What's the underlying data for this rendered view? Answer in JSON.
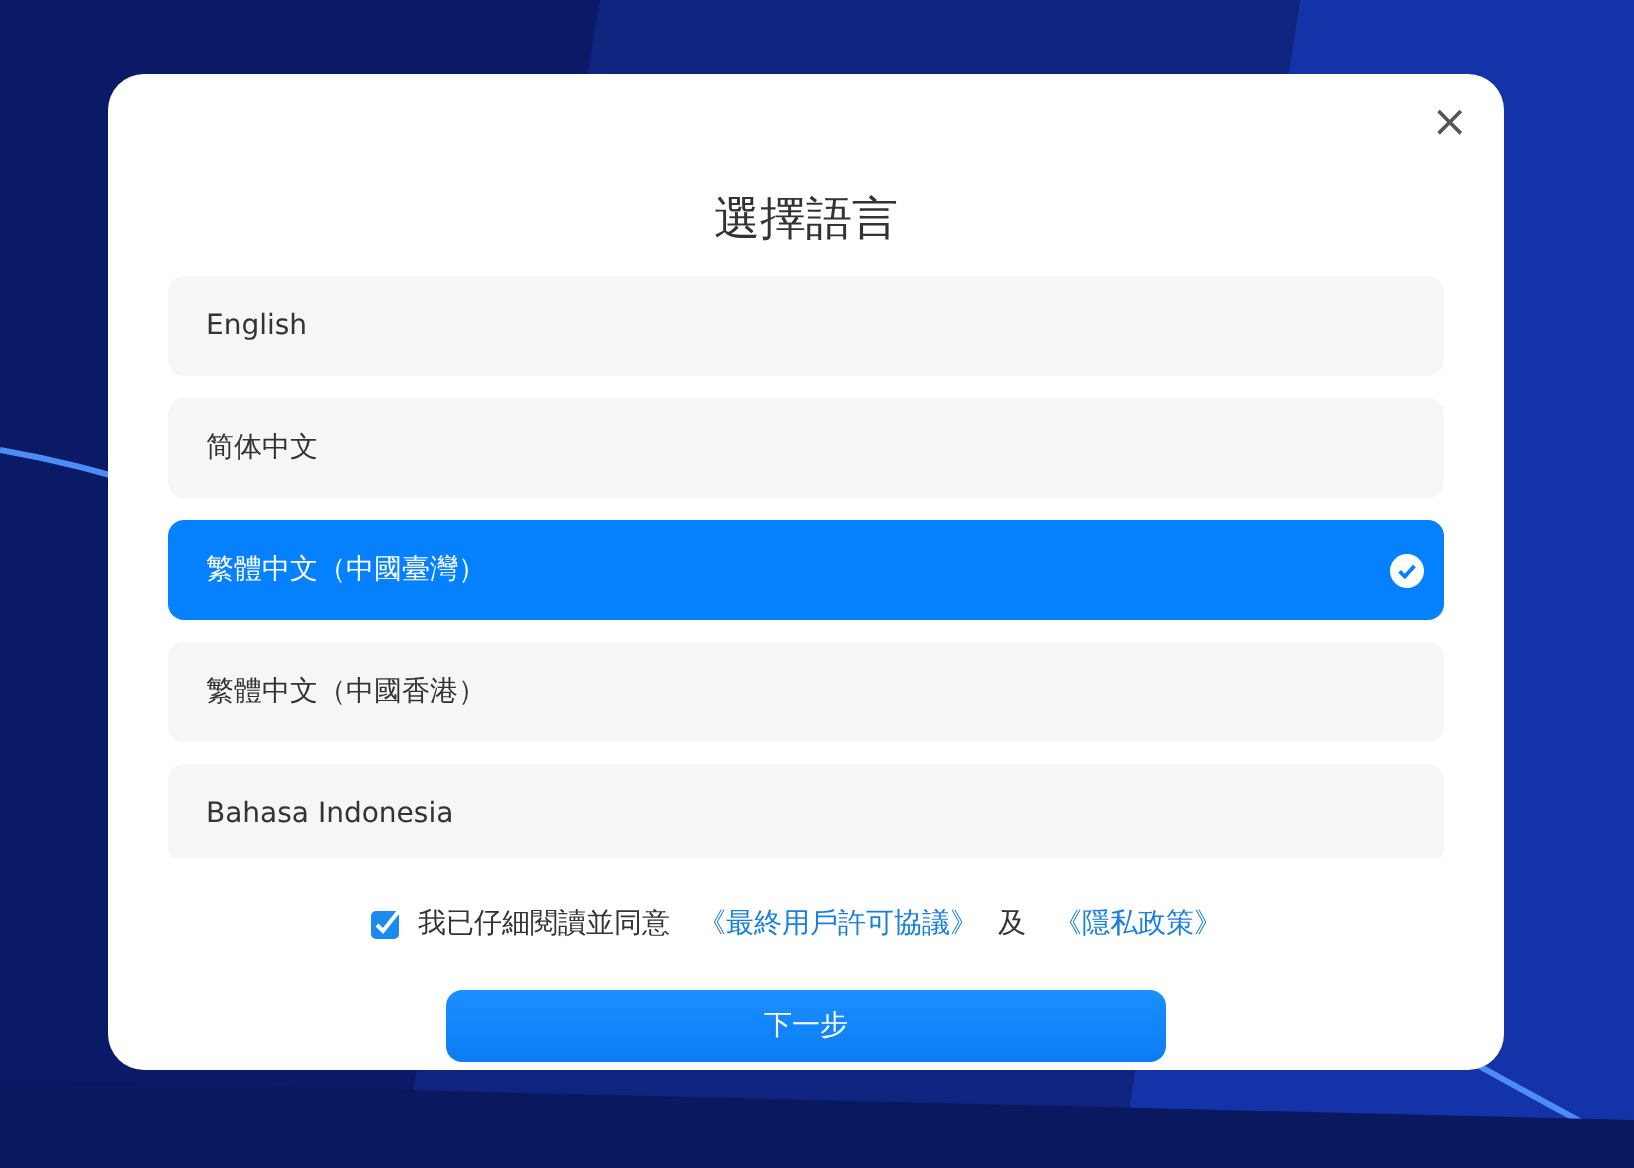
{
  "dialog": {
    "title": "選擇語言",
    "close": "×"
  },
  "languages": [
    {
      "label": "English",
      "selected": false
    },
    {
      "label": "简体中文",
      "selected": false
    },
    {
      "label": "繁體中文（中國臺灣）",
      "selected": true
    },
    {
      "label": "繁體中文（中國香港）",
      "selected": false
    },
    {
      "label": "Bahasa Indonesia",
      "selected": false
    }
  ],
  "agreement": {
    "checked": true,
    "text": "我已仔細閱讀並同意",
    "eula_link": "《最終用戶許可協議》",
    "and": "及",
    "privacy_link": "《隱私政策》"
  },
  "next_button": "下一步"
}
